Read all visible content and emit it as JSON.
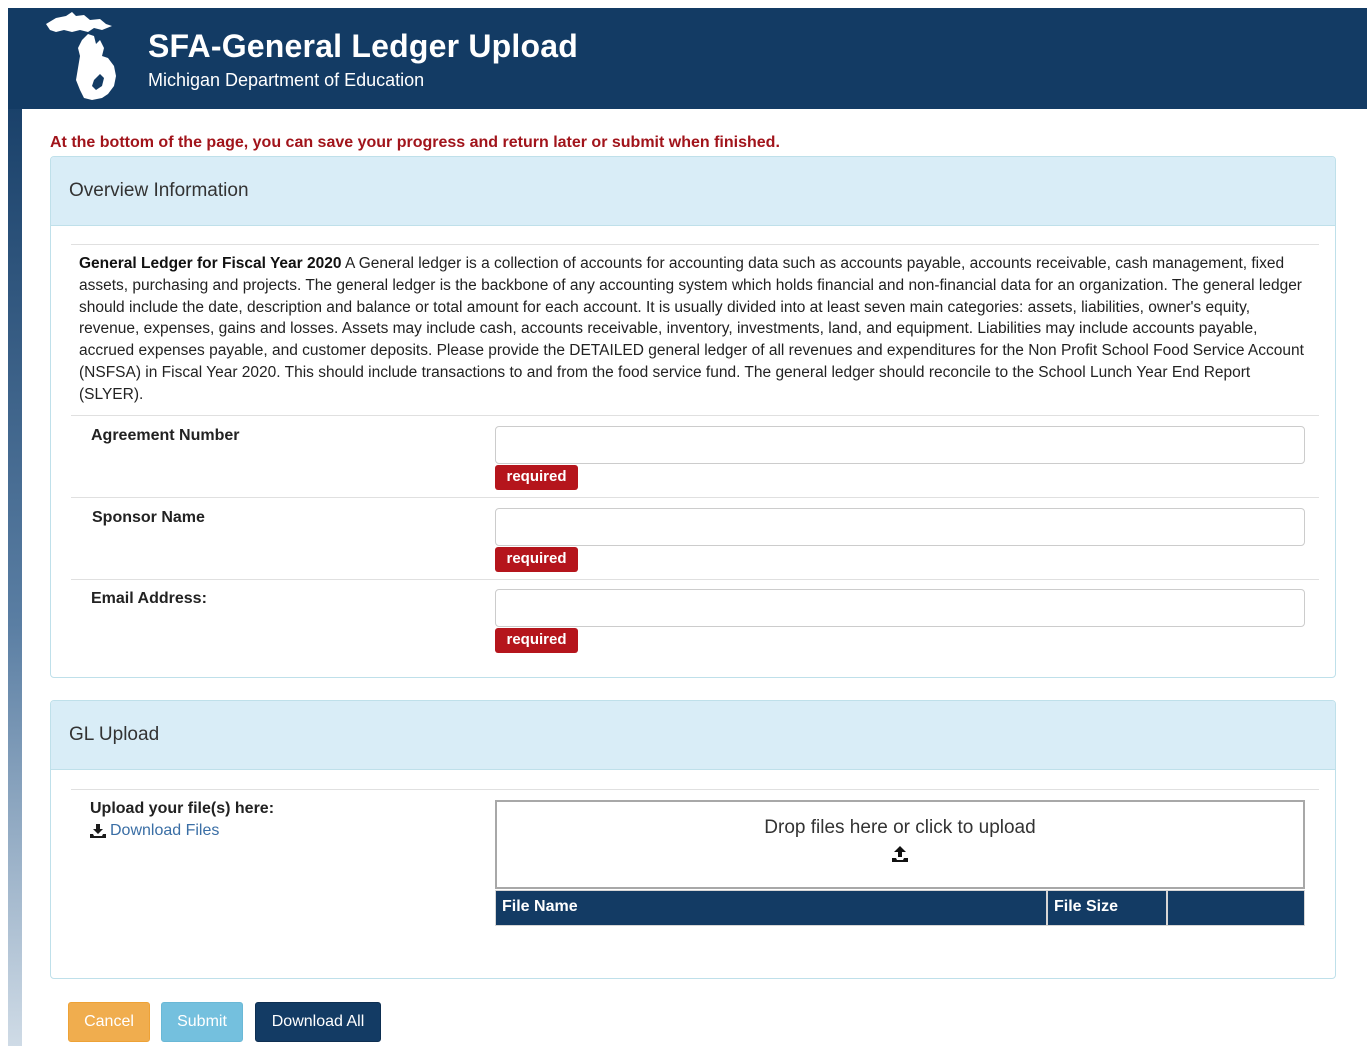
{
  "header": {
    "title": "SFA-General Ledger Upload",
    "subtitle": "Michigan Department of Education",
    "logo_icon": "michigan-state-logo-icon"
  },
  "notice": "At the bottom of the page, you can save your progress and return later or submit when finished.",
  "overview": {
    "heading": "Overview Information",
    "desc_bold": "General Ledger for Fiscal Year 2020",
    "desc_text": " A General ledger is a collection of accounts for accounting data such as accounts payable, accounts receivable, cash management, fixed assets, purchasing and projects. The general ledger is the backbone of any accounting system which holds financial and non-financial data for an organization. The general ledger should include the date, description and balance or total amount for each account. It is usually divided into at least seven main categories: assets, liabilities, owner's equity, revenue, expenses, gains and losses. Assets may include cash, accounts receivable, inventory, investments, land, and equipment. Liabilities may include accounts payable, accrued expenses payable, and customer deposits. Please provide the DETAILED general ledger of all revenues and expenditures for the Non Profit School Food Service Account (NSFSA) in Fiscal Year 2020. This should include transactions to and from the food service fund. The general ledger should reconcile to the School Lunch Year End Report (SLYER).",
    "fields": [
      {
        "label": "Agreement Number",
        "value": "",
        "badge": "required"
      },
      {
        "label": "Sponsor Name",
        "value": "",
        "badge": "required"
      },
      {
        "label": "Email Address:",
        "value": "",
        "badge": "required"
      }
    ]
  },
  "gl_upload": {
    "heading": "GL Upload",
    "label": "Upload your file(s) here:",
    "download_link": "Download Files",
    "download_icon": "download-icon",
    "dropzone_text": "Drop files here or click to upload",
    "dropzone_icon": "upload-icon",
    "table_headers": [
      "File Name",
      "File Size",
      ""
    ]
  },
  "buttons": {
    "cancel": "Cancel",
    "submit": "Submit",
    "download_all": "Download All"
  },
  "colors": {
    "header_bg": "#133b64",
    "notice_text": "#a1141b",
    "panel_heading_bg": "#d9edf7",
    "required_badge": "#b5151c",
    "cancel_button": "#f0ad4e",
    "submit_button": "#74c0de",
    "download_button": "#133b64"
  }
}
